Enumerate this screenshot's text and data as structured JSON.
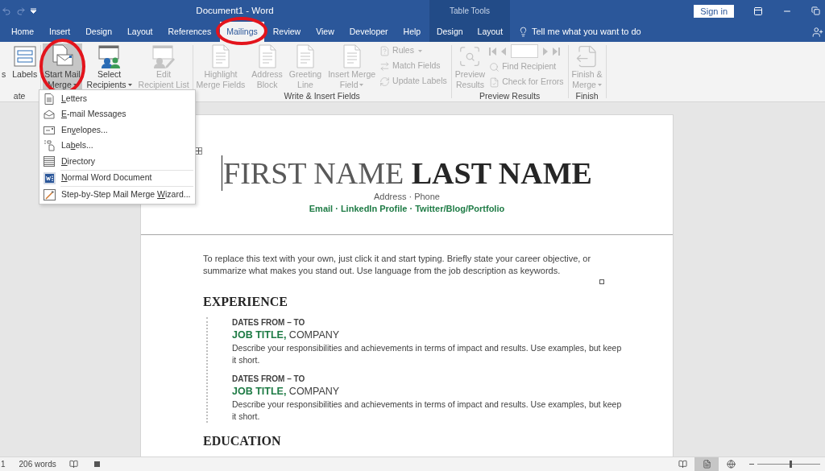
{
  "title_bar": {
    "title": "Document1  -  Word",
    "contextual_group": "Table Tools",
    "sign_in": "Sign in"
  },
  "tabs": [
    {
      "label": "Home",
      "selected": false,
      "contextual": false
    },
    {
      "label": "Insert",
      "selected": false,
      "contextual": false
    },
    {
      "label": "Design",
      "selected": false,
      "contextual": false
    },
    {
      "label": "Layout",
      "selected": false,
      "contextual": false
    },
    {
      "label": "References",
      "selected": false,
      "contextual": false
    },
    {
      "label": "Mailings",
      "selected": true,
      "contextual": false,
      "circled": true
    },
    {
      "label": "Review",
      "selected": false,
      "contextual": false
    },
    {
      "label": "View",
      "selected": false,
      "contextual": false
    },
    {
      "label": "Developer",
      "selected": false,
      "contextual": false
    },
    {
      "label": "Help",
      "selected": false,
      "contextual": false
    },
    {
      "label": "Design",
      "selected": false,
      "contextual": true
    },
    {
      "label": "Layout",
      "selected": false,
      "contextual": true
    }
  ],
  "tell_me": "Tell me what you want to do",
  "ribbon": {
    "groups": [
      {
        "label": "ate",
        "items": [
          {
            "kind": "large",
            "lines": [
              "s"
            ],
            "disabled": false
          },
          {
            "kind": "large",
            "lines": [
              "Labels"
            ],
            "disabled": false
          }
        ]
      },
      {
        "items": [
          {
            "kind": "large",
            "lines": [
              "Start Mail",
              "Merge"
            ],
            "dropdown": true,
            "pressed": true,
            "circled": true,
            "disabled": false
          },
          {
            "kind": "large",
            "lines": [
              "Select",
              "Recipients"
            ],
            "dropdown": true,
            "disabled": false
          },
          {
            "kind": "large",
            "lines": [
              "Edit",
              "Recipient List"
            ],
            "disabled": true
          }
        ]
      },
      {
        "label": "Write & Insert Fields",
        "items": [
          {
            "kind": "large",
            "lines": [
              "Highlight",
              "Merge Fields"
            ],
            "disabled": true
          },
          {
            "kind": "large",
            "lines": [
              "Address",
              "Block"
            ],
            "disabled": true
          },
          {
            "kind": "large",
            "lines": [
              "Greeting",
              "Line"
            ],
            "disabled": true
          },
          {
            "kind": "large",
            "lines": [
              "Insert Merge",
              "Field"
            ],
            "dropdown": true,
            "disabled": true
          },
          {
            "kind": "stack",
            "entries": [
              {
                "kind": "small",
                "label": "Rules",
                "dropdown": true,
                "disabled": true
              },
              {
                "kind": "small",
                "label": "Match Fields",
                "disabled": true
              },
              {
                "kind": "small",
                "label": "Update Labels",
                "disabled": true
              }
            ]
          }
        ]
      },
      {
        "label": "Preview Results",
        "items": [
          {
            "kind": "large",
            "lines": [
              "Preview",
              "Results"
            ],
            "disabled": true
          },
          {
            "kind": "stack",
            "entries": [
              {
                "kind": "nav",
                "disabled": true
              },
              {
                "kind": "small",
                "label": "Find Recipient",
                "disabled": true
              },
              {
                "kind": "small",
                "label": "Check for Errors",
                "disabled": true
              }
            ]
          }
        ]
      },
      {
        "label": "Finish",
        "items": [
          {
            "kind": "large",
            "lines": [
              "Finish &",
              "Merge"
            ],
            "dropdown": true,
            "disabled": true
          }
        ]
      }
    ]
  },
  "menu": {
    "items": [
      {
        "key": "L",
        "after": "etters"
      },
      {
        "key": "E",
        "after": "-mail Messages"
      },
      {
        "before": "En",
        "key": "v",
        "after": "elopes..."
      },
      {
        "before": "La",
        "key": "b",
        "after": "els..."
      },
      {
        "key": "D",
        "after": "irectory"
      },
      {
        "key": "N",
        "after": "ormal Word Document",
        "separator_before": true
      },
      {
        "before": "Step-by-Step Mail Merge ",
        "key": "W",
        "after": "izard...",
        "separator_before": true
      }
    ]
  },
  "document": {
    "name_first": "FIRST NAME",
    "name_last": "LAST NAME",
    "contact": "Address · Phone",
    "links": "Email · LinkedIn Profile · Twitter/Blog/Portfolio",
    "objective": "To replace this text with your own, just click it and start typing. Briefly state your career objective, or summarize what makes you stand out. Use language from the job description as keywords.",
    "sections": [
      {
        "heading": "EXPERIENCE",
        "entries": [
          {
            "dates": "DATES FROM – TO",
            "title": "JOB TITLE,",
            "company": "COMPANY",
            "description": "Describe your responsibilities and achievements in terms of impact and results. Use examples, but keep it short."
          },
          {
            "dates": "DATES FROM – TO",
            "title": "JOB TITLE,",
            "company": "COMPANY",
            "description": "Describe your responsibilities and achievements in terms of impact and results. Use examples, but keep it short."
          }
        ]
      },
      {
        "heading": "EDUCATION"
      }
    ]
  },
  "status_bar": {
    "page": "1",
    "words": "206 words",
    "views": [
      {
        "selected": false
      },
      {
        "selected": true
      },
      {
        "selected": false
      }
    ],
    "zoom": {
      "level": 0.53
    }
  }
}
